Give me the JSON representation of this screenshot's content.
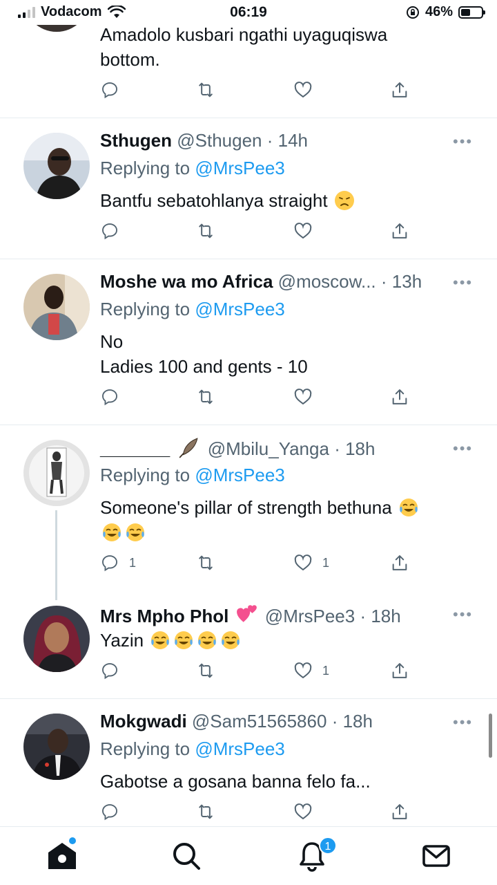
{
  "status_bar": {
    "carrier": "Vodacom",
    "time": "06:19",
    "battery": "46%",
    "battery_level": 0.46
  },
  "tweets": [
    {
      "body": [
        "Amadolo kusbari ngathi uyaguqiswa",
        "bottom."
      ],
      "actions": {
        "replies": "",
        "retweets": "",
        "likes": ""
      }
    },
    {
      "name": "Sthugen",
      "handle": "@Sthugen",
      "time": "· 14h",
      "replying_prefix": "Replying to",
      "replying_to": "@MrsPee3",
      "body": [
        "Bantfu sebatohlanya straight"
      ],
      "emoji": [
        "disappointed"
      ]
    },
    {
      "name": "Moshe wa mo Africa",
      "handle": "@moscow...",
      "time": "· 13h",
      "replying_prefix": "Replying to",
      "replying_to": "@MrsPee3",
      "body": [
        "No",
        "Ladies 100 and gents - 10"
      ]
    },
    {
      "name": "_______",
      "name_emoji": "feather",
      "handle": "@Mbilu_Yanga",
      "time": "· 18h",
      "replying_prefix": "Replying to",
      "replying_to": "@MrsPee3",
      "body": [
        "Someone's pillar of strength bethuna"
      ],
      "emoji": [
        "tears-of-joy",
        "tears-of-joy",
        "tears-of-joy"
      ],
      "actions": {
        "replies": "1",
        "likes": "1"
      }
    },
    {
      "name": "Mrs Mpho Phol",
      "name_emoji": "two-hearts",
      "handle": "@MrsPee3",
      "time": "· 18h",
      "body": [
        "Yazin"
      ],
      "emoji": [
        "tears-of-joy",
        "tears-of-joy",
        "tears-of-joy",
        "tears-of-joy"
      ],
      "actions": {
        "likes": "1"
      }
    },
    {
      "name": "Mokgwadi",
      "handle": "@Sam51565860",
      "time": "· 18h",
      "replying_prefix": "Replying to",
      "replying_to": "@MrsPee3",
      "body": [
        "Gabotse a gosana banna felo fa..."
      ]
    }
  ],
  "more_glyph": "•••",
  "bottom_nav": {
    "items": [
      "home-icon",
      "search-icon",
      "notifications-icon",
      "messages-icon"
    ],
    "notification_count": "1"
  },
  "colors": {
    "accent": "#1d9bf0",
    "secondary_text": "#536471",
    "divider": "#e6ecf0"
  }
}
